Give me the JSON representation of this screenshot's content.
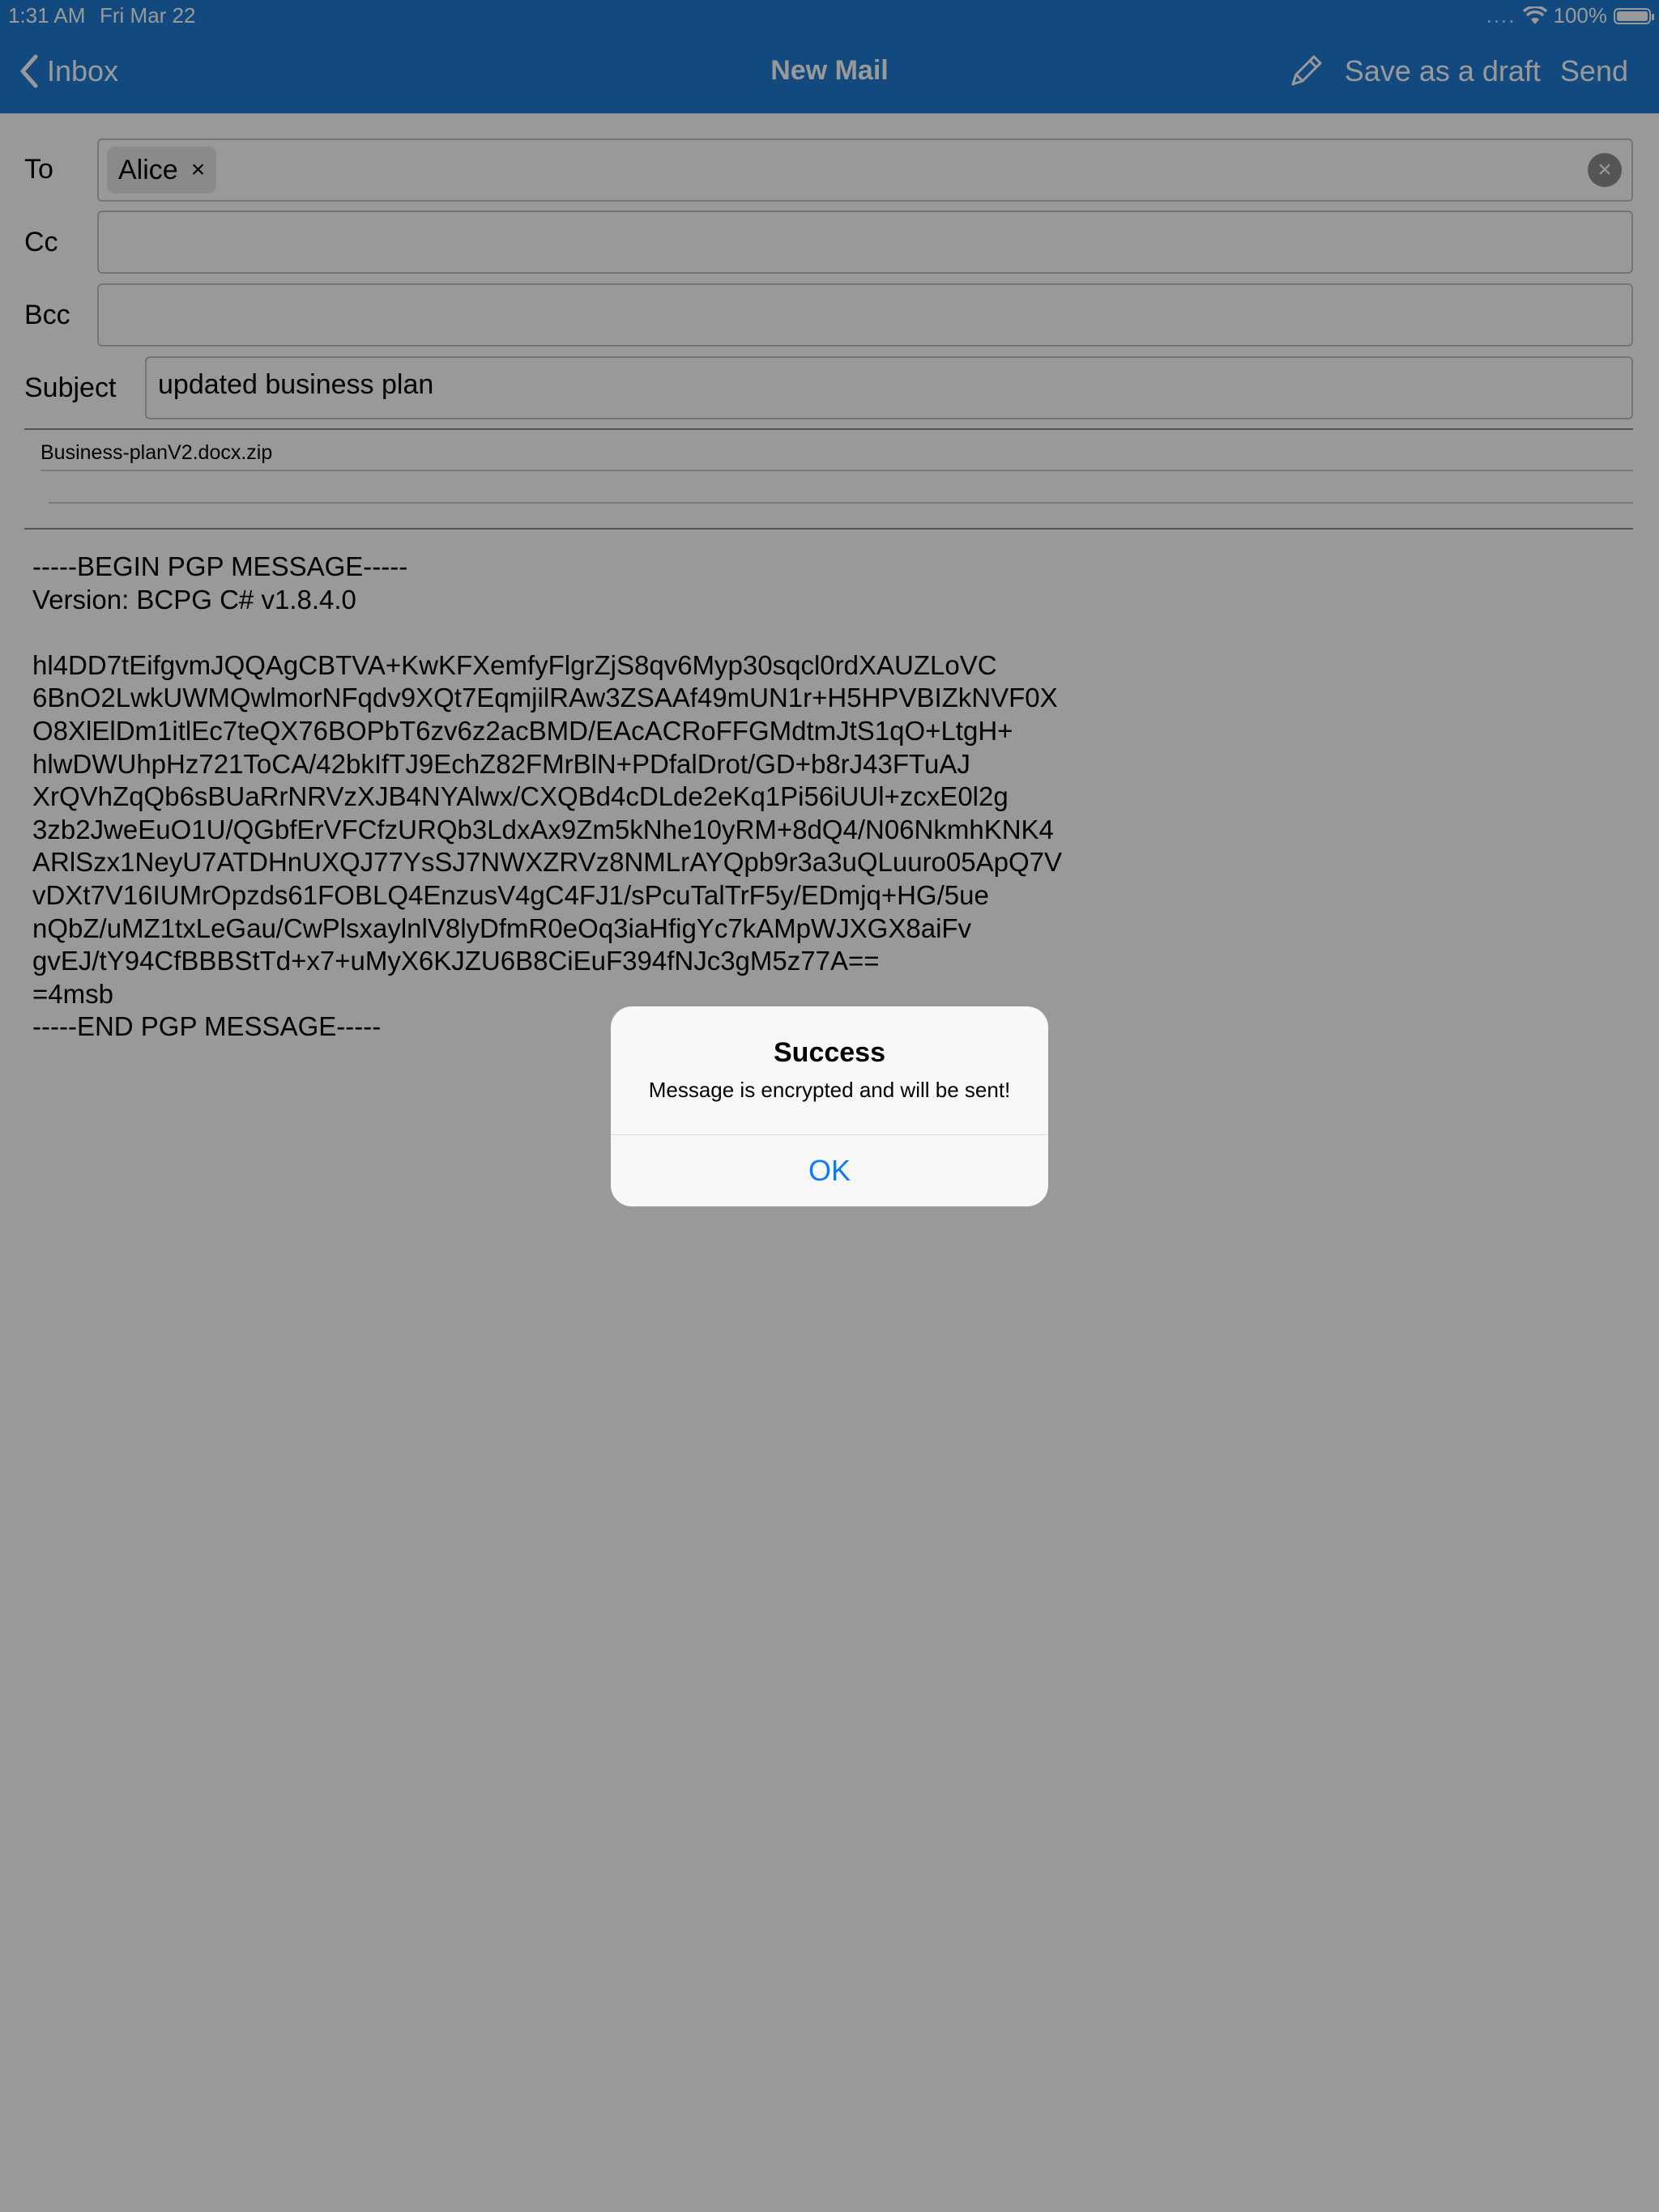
{
  "status_bar": {
    "time": "1:31 AM",
    "date": "Fri Mar 22",
    "signal": "....",
    "battery": "100%"
  },
  "nav": {
    "back_label": "Inbox",
    "title": "New Mail",
    "draft_label": "Save as a draft",
    "send_label": "Send",
    "pencil_icon": "pencil-icon"
  },
  "form": {
    "to_label": "To",
    "to_recipient": "Alice",
    "chip_remove": "×",
    "cc_label": "Cc",
    "bcc_label": "Bcc",
    "subject_label": "Subject",
    "subject_value": "updated business plan",
    "attachment": "Business-planV2.docx.zip"
  },
  "body": {
    "text": "-----BEGIN PGP MESSAGE-----\nVersion: BCPG C# v1.8.4.0\n\nhl4DD7tEifgvmJQQAgCBTVA+KwKFXemfyFlgrZjS8qv6Myp30sqcl0rdXAUZLoVC\n6BnO2LwkUWMQwlmorNFqdv9XQt7EqmjilRAw3ZSAAf49mUN1r+H5HPVBIZkNVF0X\nO8XlElDm1itlEc7teQX76BOPbT6zv6z2acBMD/EAcACRoFFGMdtmJtS1qO+LtgH+\nhlwDWUhpHz721ToCA/42bkIfTJ9EchZ82FMrBlN+PDfalDrot/GD+b8rJ43FTuAJ\nXrQVhZqQb6sBUaRrNRVzXJB4NYAlwx/CXQBd4cDLde2eKq1Pi56iUUl+zcxE0l2g\n3zb2JweEuO1U/QGbfErVFCfzURQb3LdxAx9Zm5kNhe10yRM+8dQ4/N06NkmhKNK4\nARlSzx1NeyU7ATDHnUXQJ77YsSJ7NWXZRVz8NMLrAYQpb9r3a3uQLuuro05ApQ7V\nvDXt7V16IUMrOpzds61FOBLQ4EnzusV4gC4FJ1/sPcuTalTrF5y/EDmjq+HG/5ue\nnQbZ/uMZ1txLeGau/CwPlsxaylnlV8lyDfmR0eOq3iaHfigYc7kAMpWJXGX8aiFv\ngvEJ/tY94CfBBBStTd+x7+uMyX6KJZU6B8CiEuF394fNJc3gM5z77A==\n=4msb\n-----END PGP MESSAGE-----"
  },
  "alert": {
    "title": "Success",
    "message": "Message is encrypted and will be sent!",
    "ok_label": "OK"
  },
  "colors": {
    "nav_bar": "#1f7ad3",
    "alert_button": "#0a7aff",
    "overlay": "rgba(0,0,0,0.4)"
  }
}
